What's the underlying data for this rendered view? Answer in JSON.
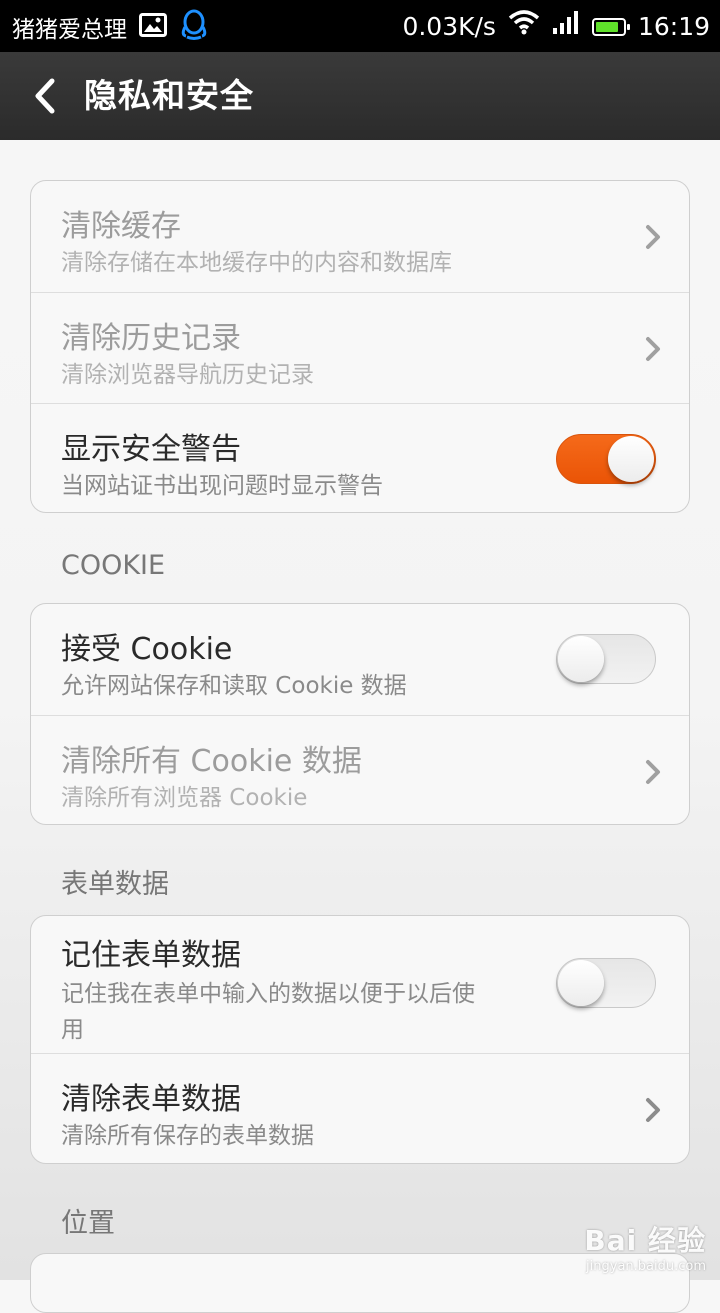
{
  "status_bar": {
    "carrier": "猪猪爱总理",
    "net_speed": "0.03K/s",
    "time": "16:19",
    "battery_color": "#5fe02a",
    "battery_level": 0.85,
    "icons": [
      "image-icon",
      "qq-icon",
      "wifi-icon",
      "signal-icon",
      "battery-icon"
    ]
  },
  "title_bar": {
    "title": "隐私和安全"
  },
  "groups": {
    "privacy": {
      "rows": [
        {
          "title": "清除缓存",
          "subtitle": "清除存储在本地缓存中的内容和数据库",
          "control": "chevron",
          "enabled": false
        },
        {
          "title": "清除历史记录",
          "subtitle": "清除浏览器导航历史记录",
          "control": "chevron",
          "enabled": false
        },
        {
          "title": "显示安全警告",
          "subtitle": "当网站证书出现问题时显示警告",
          "control": "toggle",
          "on": true,
          "enabled": true
        }
      ]
    },
    "cookie": {
      "label": "COOKIE",
      "rows": [
        {
          "title": "接受 Cookie",
          "subtitle": "允许网站保存和读取 Cookie 数据",
          "control": "toggle",
          "on": false,
          "enabled": true
        },
        {
          "title": "清除所有 Cookie 数据",
          "subtitle": "清除所有浏览器 Cookie",
          "control": "chevron",
          "enabled": false
        }
      ]
    },
    "form": {
      "label": "表单数据",
      "rows": [
        {
          "title": "记住表单数据",
          "subtitle_line1": "记住我在表单中输入的数据以便于以后使",
          "subtitle_line2": "用",
          "control": "toggle",
          "on": false,
          "enabled": true
        },
        {
          "title": "清除表单数据",
          "subtitle": "清除所有保存的表单数据",
          "control": "chevron",
          "enabled": true
        }
      ]
    },
    "location": {
      "label": "位置"
    }
  },
  "colors": {
    "toggle_on": "#f26014",
    "title_bar": "#2f2f2f"
  },
  "watermark": {
    "logo": "Bai 经验",
    "url": "jingyan.baidu.com"
  }
}
